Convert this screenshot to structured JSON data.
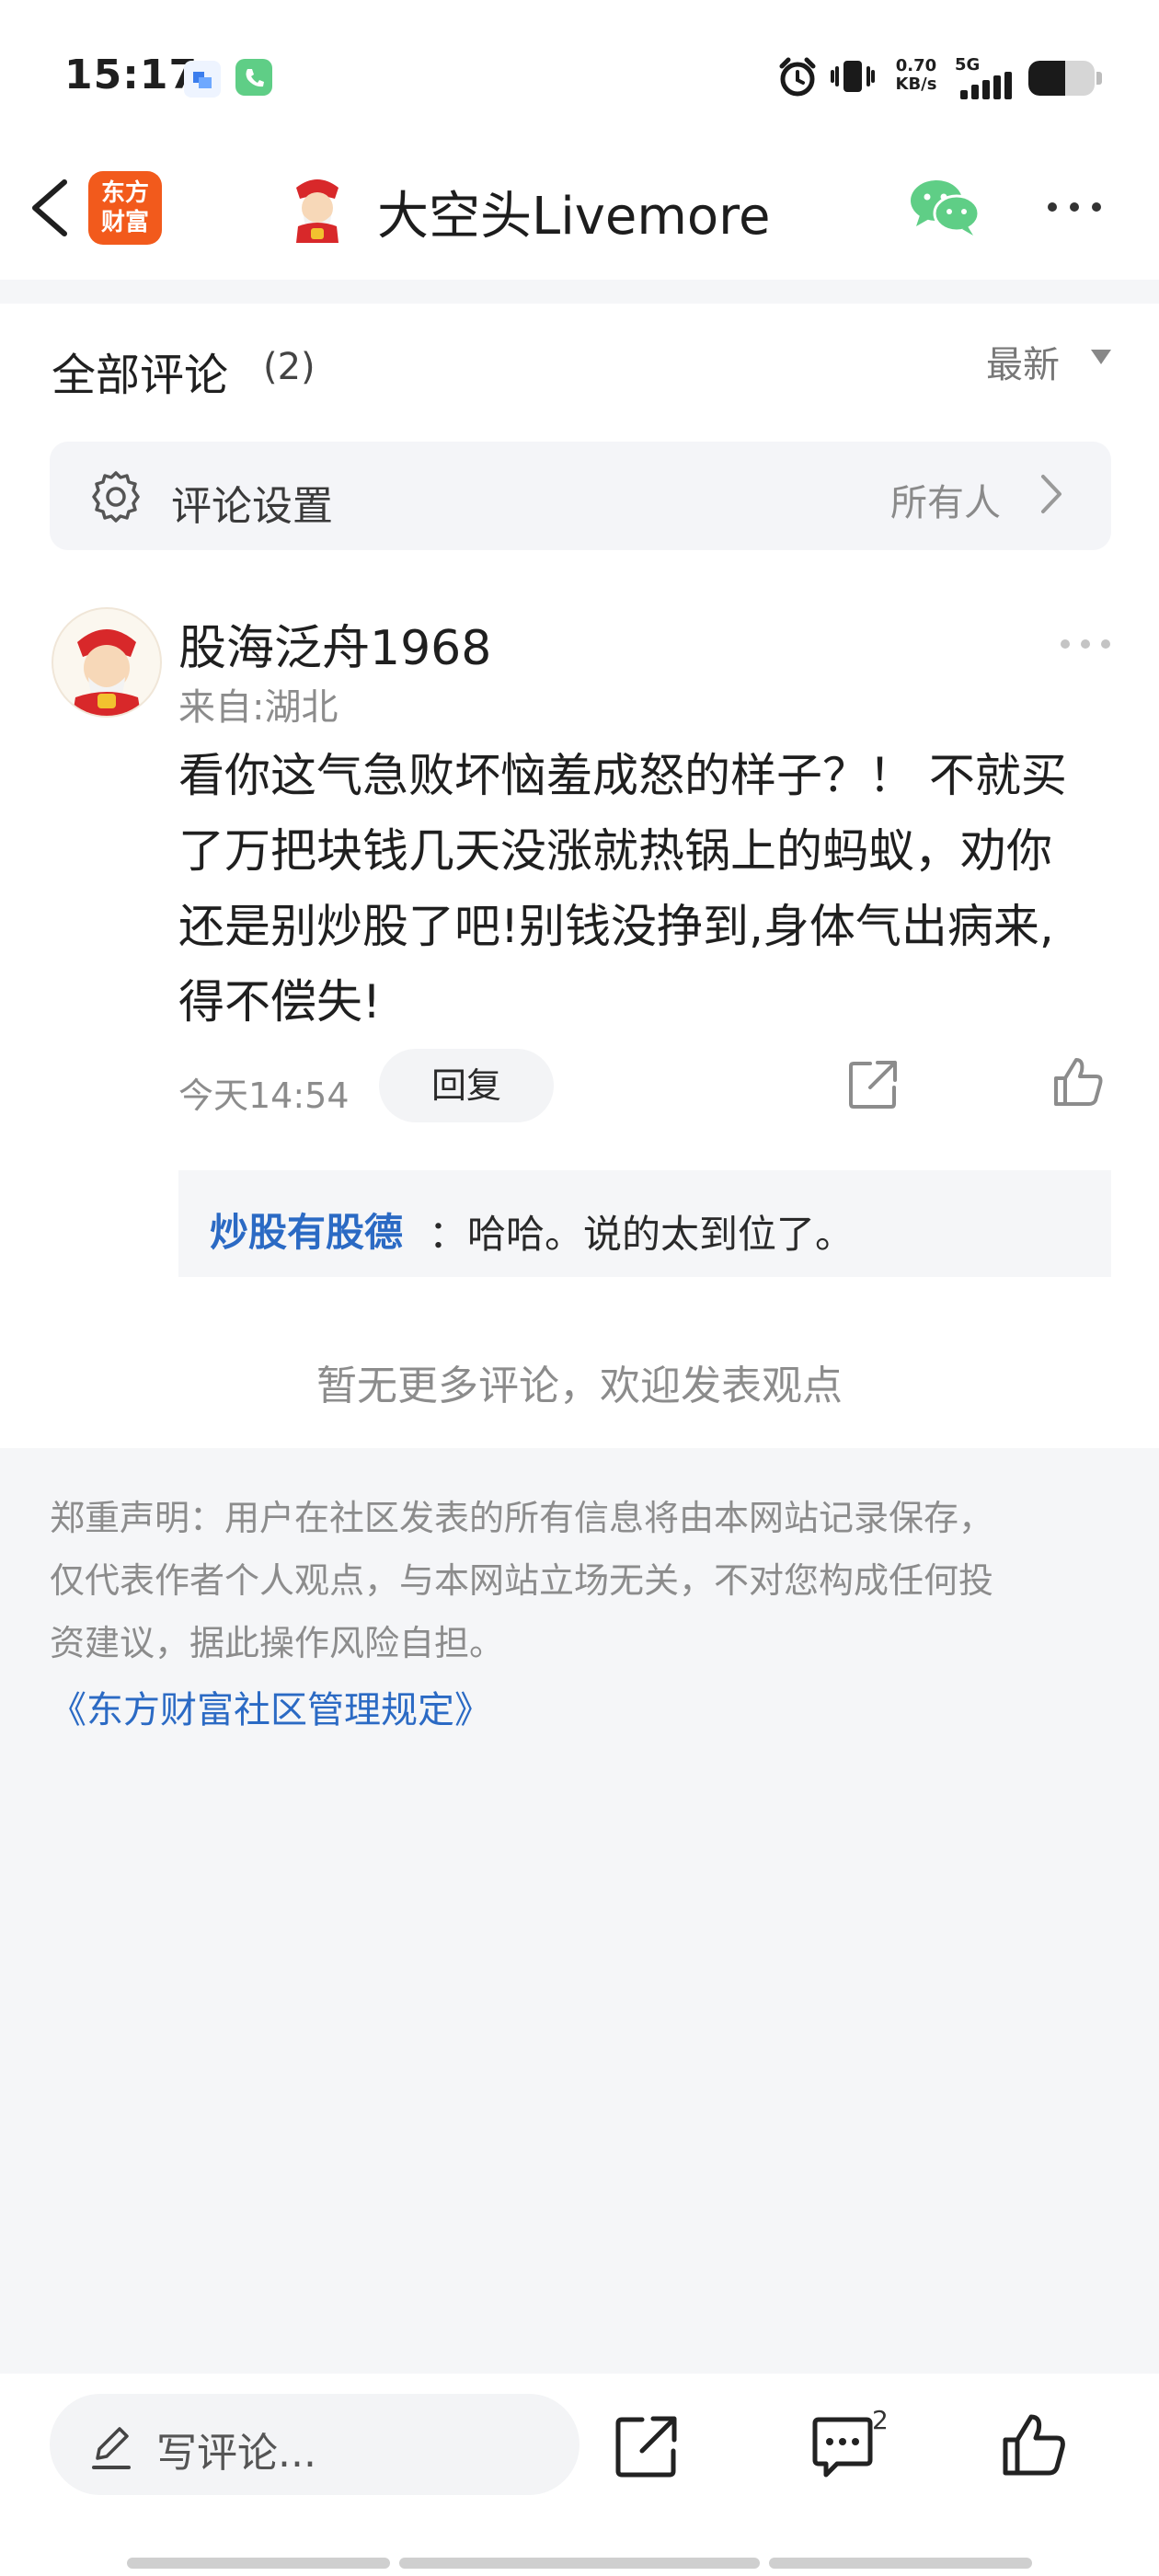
{
  "status_bar": {
    "time": "15:17",
    "net_speed_value": "0.70",
    "net_speed_unit": "KB/s",
    "network": "5G",
    "battery_level": 0.55
  },
  "header": {
    "logo_text_line1": "东方",
    "logo_text_line2": "财富",
    "title": "大空头Livemore",
    "icons": [
      "back-chevron-icon",
      "fortune-god-avatar-icon",
      "wechat-icon",
      "more-dots-icon"
    ]
  },
  "comments_section": {
    "title": "全部评论",
    "count": "(2)",
    "sort_label": "最新",
    "settings": {
      "label": "评论设置",
      "value": "所有人"
    }
  },
  "comment": {
    "username": "股海泛舟1968",
    "location": "来自:湖北",
    "lines": [
      "看你这气急败坏恼羞成怒的样子？！ 不就买",
      "了万把块钱几天没涨就热锅上的蚂蚁，劝你",
      "还是别炒股了吧!别钱没挣到,身体气出病来,",
      "得不偿失!"
    ],
    "time": "今天14:54",
    "reply_label": "回复",
    "sub_reply": {
      "name": "炒股有股德",
      "text": "：哈哈。说的太到位了。"
    }
  },
  "no_more_text": "暂无更多评论，欢迎发表观点",
  "disclaimer": {
    "lines": [
      "郑重声明：用户在社区发表的所有信息将由本网站记录保存，",
      "仅代表作者个人观点，与本网站立场无关，不对您构成任何投",
      "资建议，据此操作风险自担。"
    ],
    "link": "《东方财富社区管理规定》"
  },
  "bottom_bar": {
    "write_placeholder": "写评论...",
    "comment_count": "2"
  },
  "colors": {
    "brand_orange": "#f25a1c",
    "link_blue": "#2b6ac4",
    "wechat_green": "#5fce86"
  }
}
